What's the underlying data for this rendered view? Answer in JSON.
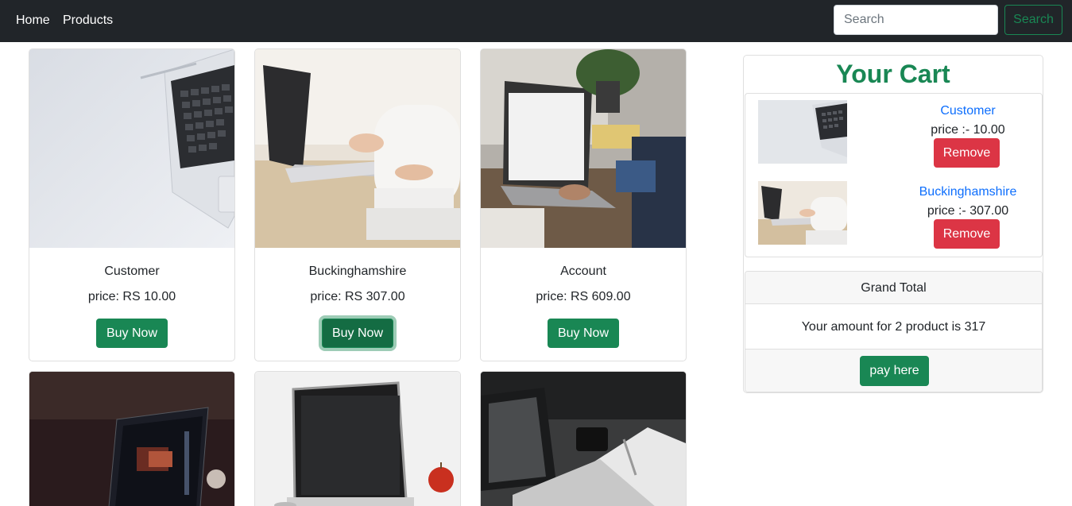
{
  "nav": {
    "links": [
      "Home",
      "Products"
    ],
    "search_placeholder": "Search",
    "search_button": "Search"
  },
  "products": [
    {
      "name": "Customer",
      "price": "price: RS 10.00",
      "button": "Buy Now",
      "image": "laptop-keyboard-photo"
    },
    {
      "name": "Buckinghamshire",
      "price": "price: RS 307.00",
      "button": "Buy Now",
      "image": "person-typing-laptop-photo"
    },
    {
      "name": "Account",
      "price": "price: RS 609.00",
      "button": "Buy Now",
      "image": "laptop-desk-office-photo"
    },
    {
      "image": "laptop-dark-photo"
    },
    {
      "image": "laptop-apple-photo"
    },
    {
      "image": "laptop-notebook-photo"
    }
  ],
  "cart": {
    "title": "Your Cart",
    "items": [
      {
        "name": "Customer",
        "price": "price :- 10.00",
        "button": "Remove"
      },
      {
        "name": "Buckinghamshire",
        "price": "price :- 307.00",
        "button": "Remove"
      }
    ],
    "total_header": "Grand Total",
    "total_text": "Your amount for 2 product is 317",
    "pay_button": "pay here"
  },
  "colors": {
    "navbar": "#212529",
    "success": "#198754",
    "danger": "#dc3545",
    "link": "#0d6efd"
  }
}
